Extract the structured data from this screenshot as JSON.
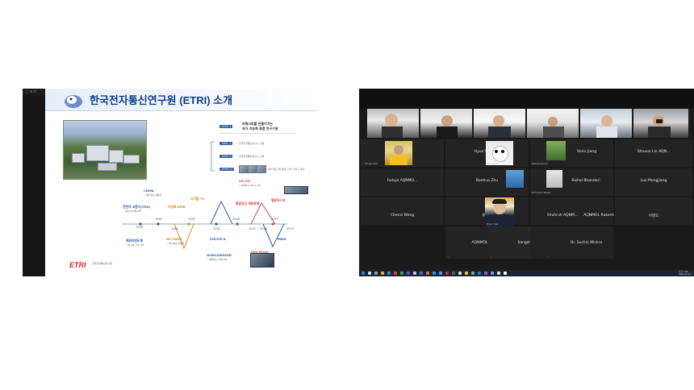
{
  "left_window": {
    "mini_label": "○ ⊕ ⊡",
    "slide": {
      "title": "한국전자통신연구원 (ETRI) 소개",
      "top_right_year": "2020.1",
      "top_right_headline": "피해사회를 만들어가는",
      "top_right_headline2": "국가 지능화 종합 연구기관",
      "rows": [
        {
          "year": "1981.1",
          "text": "한국전자통신연구소 출범"
        },
        {
          "year": "1992.1",
          "text": "한국전자통신연구소 출범"
        },
        {
          "year": "1976.12",
          "text": "8대 핵심 혁신전문 인력 IT연구 성과"
        }
      ],
      "milestones": [
        {
          "label": "CDMA",
          "color": "#2a5aa8"
        },
        {
          "label": "전전자 교환기(TDX)",
          "color": "#2a5aa8"
        },
        {
          "label": "메모리반도체",
          "color": "#2a5aa8"
        },
        {
          "label": "지상파 DMB",
          "color": "#2a5aa8"
        },
        {
          "label": "4G LTE",
          "color": "#d14b4b"
        },
        {
          "label": "디지털 TV",
          "color": "#d28a1a"
        },
        {
          "label": "OLED/AMOLED",
          "color": "#2a5aa8"
        },
        {
          "label": "LTE/LTE-A",
          "color": "#2a5aa8"
        },
        {
          "label": "Wi-CDMA",
          "color": "#d28a1a"
        },
        {
          "label": "MMH",
          "color": "#2a5aa8"
        },
        {
          "label": "SKO Blaze",
          "color": "#d14b4b"
        },
        {
          "label": "통합전산 재동종제",
          "color": "#d14b4b"
        },
        {
          "label": "엘뮤직스처",
          "color": "#d14b4b"
        }
      ],
      "timeline_years": [
        "1978",
        "1980",
        "1984",
        "1990",
        "2002",
        "2006",
        "2010 ~ 2016",
        "2017",
        "2019"
      ],
      "logo_text": "ETRI",
      "logo_sub": "한국전자통신연구원"
    }
  },
  "meeting": {
    "participants": [
      {
        "name": "Hyun Soo Kim",
        "tag": "Hyun Soo Kim"
      },
      {
        "name": "",
        "tag": "Jiwon Kim"
      },
      {
        "name": "",
        "tag": "Nabeel Jibola"
      },
      {
        "name": "Shiru Jiang",
        "tag": ""
      },
      {
        "name": "Shuxun Lin AQN...",
        "tag": ""
      },
      {
        "name": "Rutuja AQNMO...",
        "tag": ""
      },
      {
        "name": "Baohua Zhu",
        "tag": ""
      },
      {
        "name": "Bishal Bhandari",
        "tag": "Edmund Hitoshi"
      },
      {
        "name": "Luo Mengjiang",
        "tag": ""
      },
      {
        "name": "Chenxi Wang",
        "tag": ""
      },
      {
        "name": "Ijinko",
        "tag": ""
      },
      {
        "name": "Shuhruh AQNM...",
        "tag": "Hyun Soo"
      },
      {
        "name": "AQNMOL Rakesh",
        "tag": ""
      },
      {
        "name": "이영호",
        "tag": ""
      },
      {
        "name": "AQNMOL Ahasan",
        "tag": ""
      },
      {
        "name": "Sangshin Lee",
        "tag": ""
      },
      {
        "name": "Dr. Suchin Mishra",
        "tag": ""
      }
    ],
    "clock_time": "오전 7:06",
    "clock_date": "2021-06-24"
  }
}
